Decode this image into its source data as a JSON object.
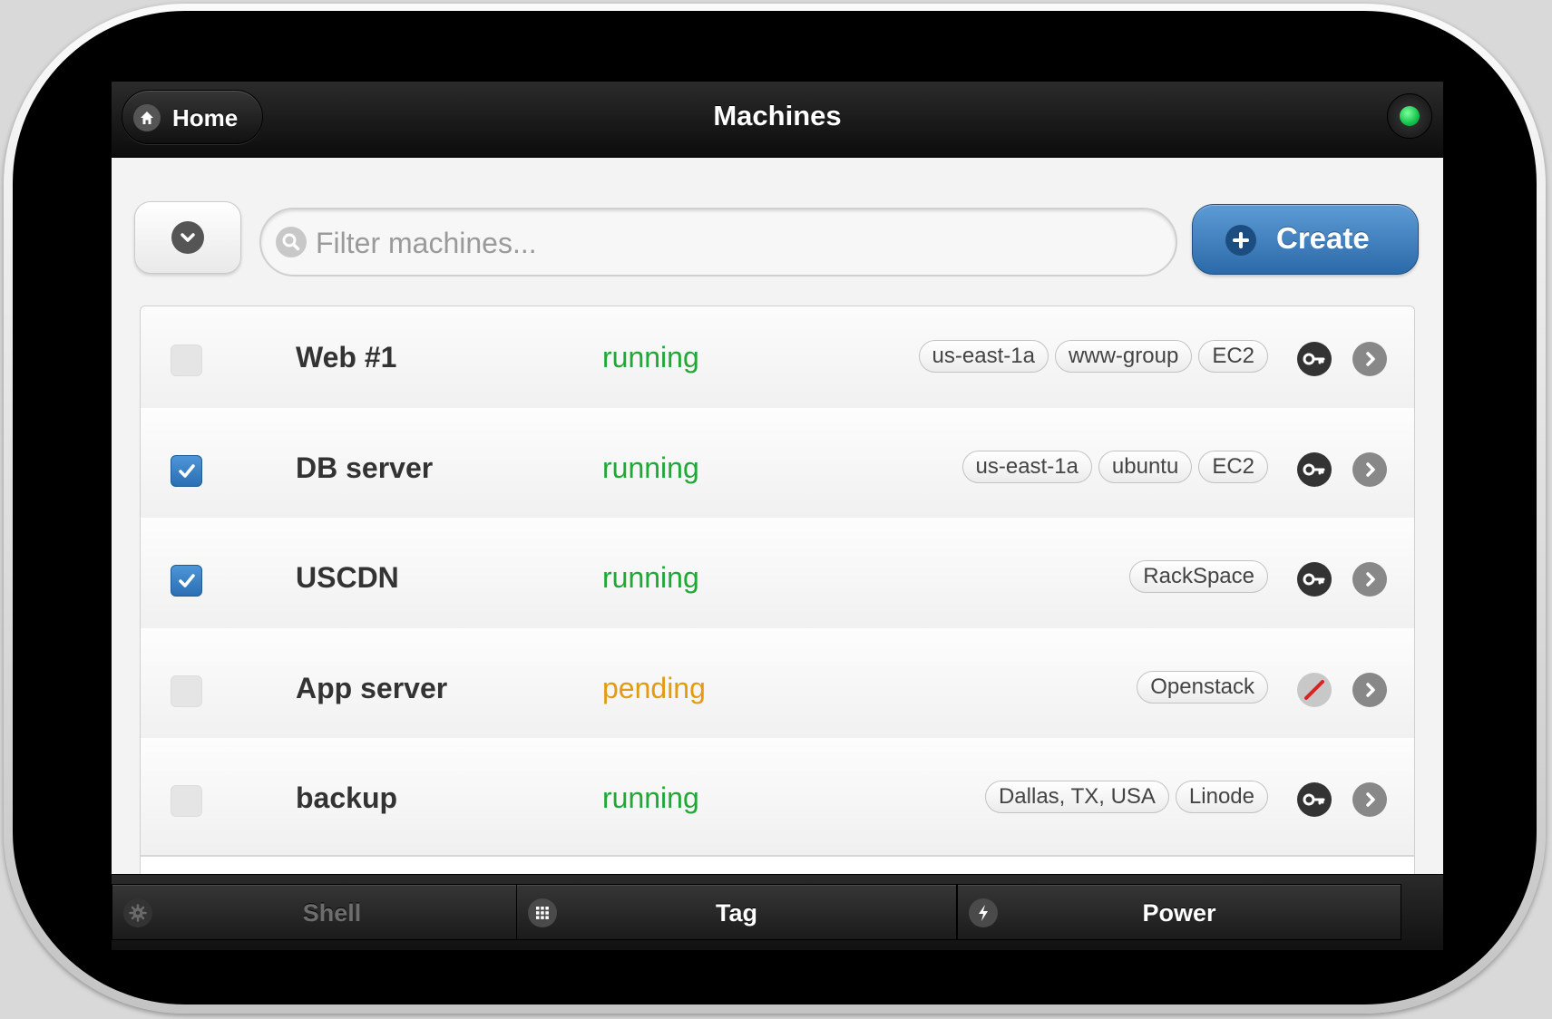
{
  "header": {
    "home_label": "Home",
    "title": "Machines",
    "status_icon": "online-indicator",
    "status_color": "#12c24a"
  },
  "toolbar": {
    "dropdown_icon": "chevron-down-icon",
    "search_placeholder": "Filter machines...",
    "search_value": "",
    "create_label": "Create",
    "create_color": "#2b6aa8"
  },
  "machines": [
    {
      "name": "Web #1",
      "state": "running",
      "checked": false,
      "tags": [
        "us-east-1a",
        "www-group",
        "EC2"
      ],
      "key": true
    },
    {
      "name": "DB server",
      "state": "running",
      "checked": true,
      "tags": [
        "us-east-1a",
        "ubuntu",
        "EC2"
      ],
      "key": true
    },
    {
      "name": "USCDN",
      "state": "running",
      "checked": true,
      "tags": [
        "RackSpace"
      ],
      "key": true
    },
    {
      "name": "App server",
      "state": "pending",
      "checked": false,
      "tags": [
        "Openstack"
      ],
      "key": false
    },
    {
      "name": "backup",
      "state": "running",
      "checked": false,
      "tags": [
        "Dallas, TX, USA",
        "Linode"
      ],
      "key": true
    }
  ],
  "state_colors": {
    "running": "#1fa836",
    "pending": "#e39b13"
  },
  "footer": {
    "shell_label": "Shell",
    "shell_disabled": true,
    "tag_label": "Tag",
    "power_label": "Power"
  }
}
